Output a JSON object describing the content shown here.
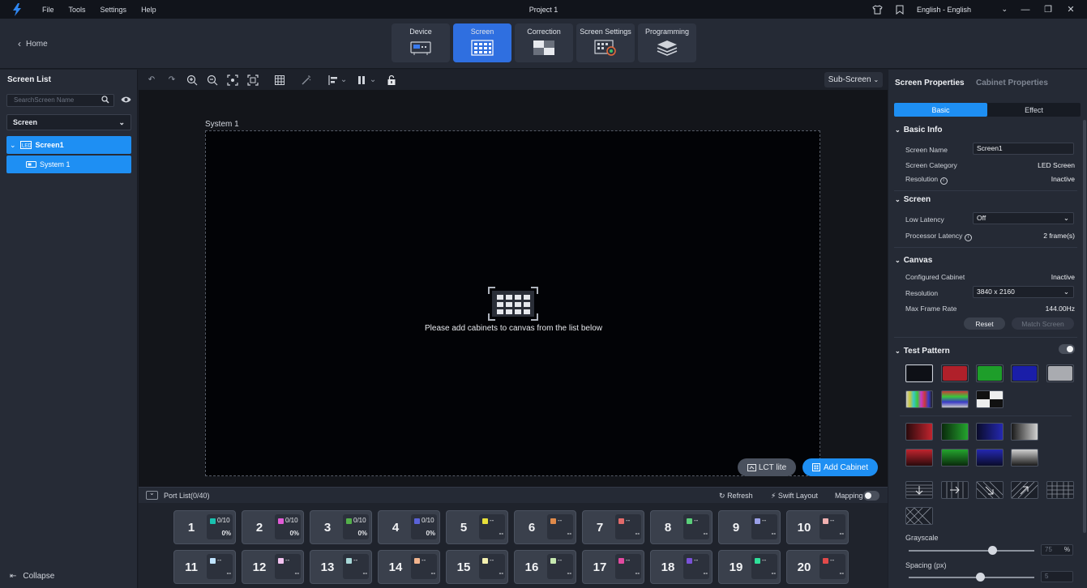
{
  "titlebar": {
    "menu": [
      "File",
      "Tools",
      "Settings",
      "Help"
    ],
    "title": "Project 1",
    "language": "English - English"
  },
  "topbar": {
    "home_label": "Home",
    "tabs": [
      {
        "label": "Device",
        "icon": "device-icon",
        "active": false
      },
      {
        "label": "Screen",
        "icon": "screen-grid-icon",
        "active": true
      },
      {
        "label": "Correction",
        "icon": "correction-icon",
        "active": false
      },
      {
        "label": "Screen Settings",
        "icon": "screen-settings-icon",
        "active": false
      },
      {
        "label": "Programming",
        "icon": "layers-icon",
        "active": false
      }
    ]
  },
  "left_panel": {
    "title": "Screen List",
    "search_placeholder": "SearchScreen Name",
    "filter_value": "Screen",
    "tree": [
      {
        "label": "Screen1",
        "level": 0
      },
      {
        "label": "System 1",
        "level": 1
      }
    ],
    "collapse_label": "Collapse"
  },
  "canvas": {
    "subscreen_label": "Sub-Screen",
    "system_label": "System 1",
    "message": "Please add cabinets to canvas from the list below",
    "lct_label": "LCT lite",
    "add_cabinet_label": "Add Cabinet"
  },
  "port_bar": {
    "title": "Port List(0/40)",
    "refresh": "Refresh",
    "swift_layout": "Swift Layout",
    "mapping": "Mapping"
  },
  "ports": [
    {
      "num": "1",
      "count": "0/10",
      "pct": "0%",
      "color": "#19c2b0"
    },
    {
      "num": "2",
      "count": "0/10",
      "pct": "0%",
      "color": "#e25bd6"
    },
    {
      "num": "3",
      "count": "0/10",
      "pct": "0%",
      "color": "#53b04a"
    },
    {
      "num": "4",
      "count": "0/10",
      "pct": "0%",
      "color": "#5a62d8"
    },
    {
      "num": "5",
      "count": "--",
      "pct": "--",
      "color": "#e8e03a"
    },
    {
      "num": "6",
      "count": "--",
      "pct": "--",
      "color": "#e08a4a"
    },
    {
      "num": "7",
      "count": "--",
      "pct": "--",
      "color": "#e26a6a"
    },
    {
      "num": "8",
      "count": "--",
      "pct": "--",
      "color": "#5ad07a"
    },
    {
      "num": "9",
      "count": "--",
      "pct": "--",
      "color": "#9aa0e8"
    },
    {
      "num": "10",
      "count": "--",
      "pct": "--",
      "color": "#f0b0b0"
    },
    {
      "num": "11",
      "count": "--",
      "pct": "--",
      "color": "#bfe3ff"
    },
    {
      "num": "12",
      "count": "--",
      "pct": "--",
      "color": "#f3c3f0"
    },
    {
      "num": "13",
      "count": "--",
      "pct": "--",
      "color": "#a8d8d8"
    },
    {
      "num": "14",
      "count": "--",
      "pct": "--",
      "color": "#f2b48e"
    },
    {
      "num": "15",
      "count": "--",
      "pct": "--",
      "color": "#f4f0b0"
    },
    {
      "num": "16",
      "count": "--",
      "pct": "--",
      "color": "#c6e8b0"
    },
    {
      "num": "17",
      "count": "--",
      "pct": "--",
      "color": "#e24aa0"
    },
    {
      "num": "18",
      "count": "--",
      "pct": "--",
      "color": "#7a52d8"
    },
    {
      "num": "19",
      "count": "--",
      "pct": "--",
      "color": "#2fe09a"
    },
    {
      "num": "20",
      "count": "--",
      "pct": "--",
      "color": "#e24a4a"
    }
  ],
  "right_panel": {
    "tab_screen": "Screen Properties",
    "tab_cabinet": "Cabinet Properties",
    "seg_basic": "Basic",
    "seg_effect": "Effect",
    "basic_info": {
      "title": "Basic Info",
      "name_label": "Screen Name",
      "name_value": "Screen1",
      "category_label": "Screen Category",
      "category_value": "LED Screen",
      "resolution_label": "Resolution",
      "resolution_value": "Inactive"
    },
    "screen": {
      "title": "Screen",
      "low_latency_label": "Low Latency",
      "low_latency_value": "Off",
      "proc_latency_label": "Processor Latency",
      "proc_latency_value": "2 frame(s)"
    },
    "canvas": {
      "title": "Canvas",
      "configured_label": "Configured Cabinet",
      "configured_value": "Inactive",
      "resolution_label": "Resolution",
      "resolution_value": "3840 x 2160",
      "max_fr_label": "Max Frame Rate",
      "max_fr_value": "144.00Hz",
      "reset": "Reset",
      "match": "Match Screen"
    },
    "test_pattern": {
      "title": "Test Pattern",
      "enabled": false,
      "solid_colors": [
        "#0e1016",
        "#b0202a",
        "#1e9e2a",
        "#1a1ea8",
        "#a9abb0"
      ],
      "grayscale_label": "Grayscale",
      "grayscale_value": "75",
      "grayscale_unit": "%",
      "spacing_label": "Spacing (px)",
      "spacing_value": "5"
    }
  }
}
